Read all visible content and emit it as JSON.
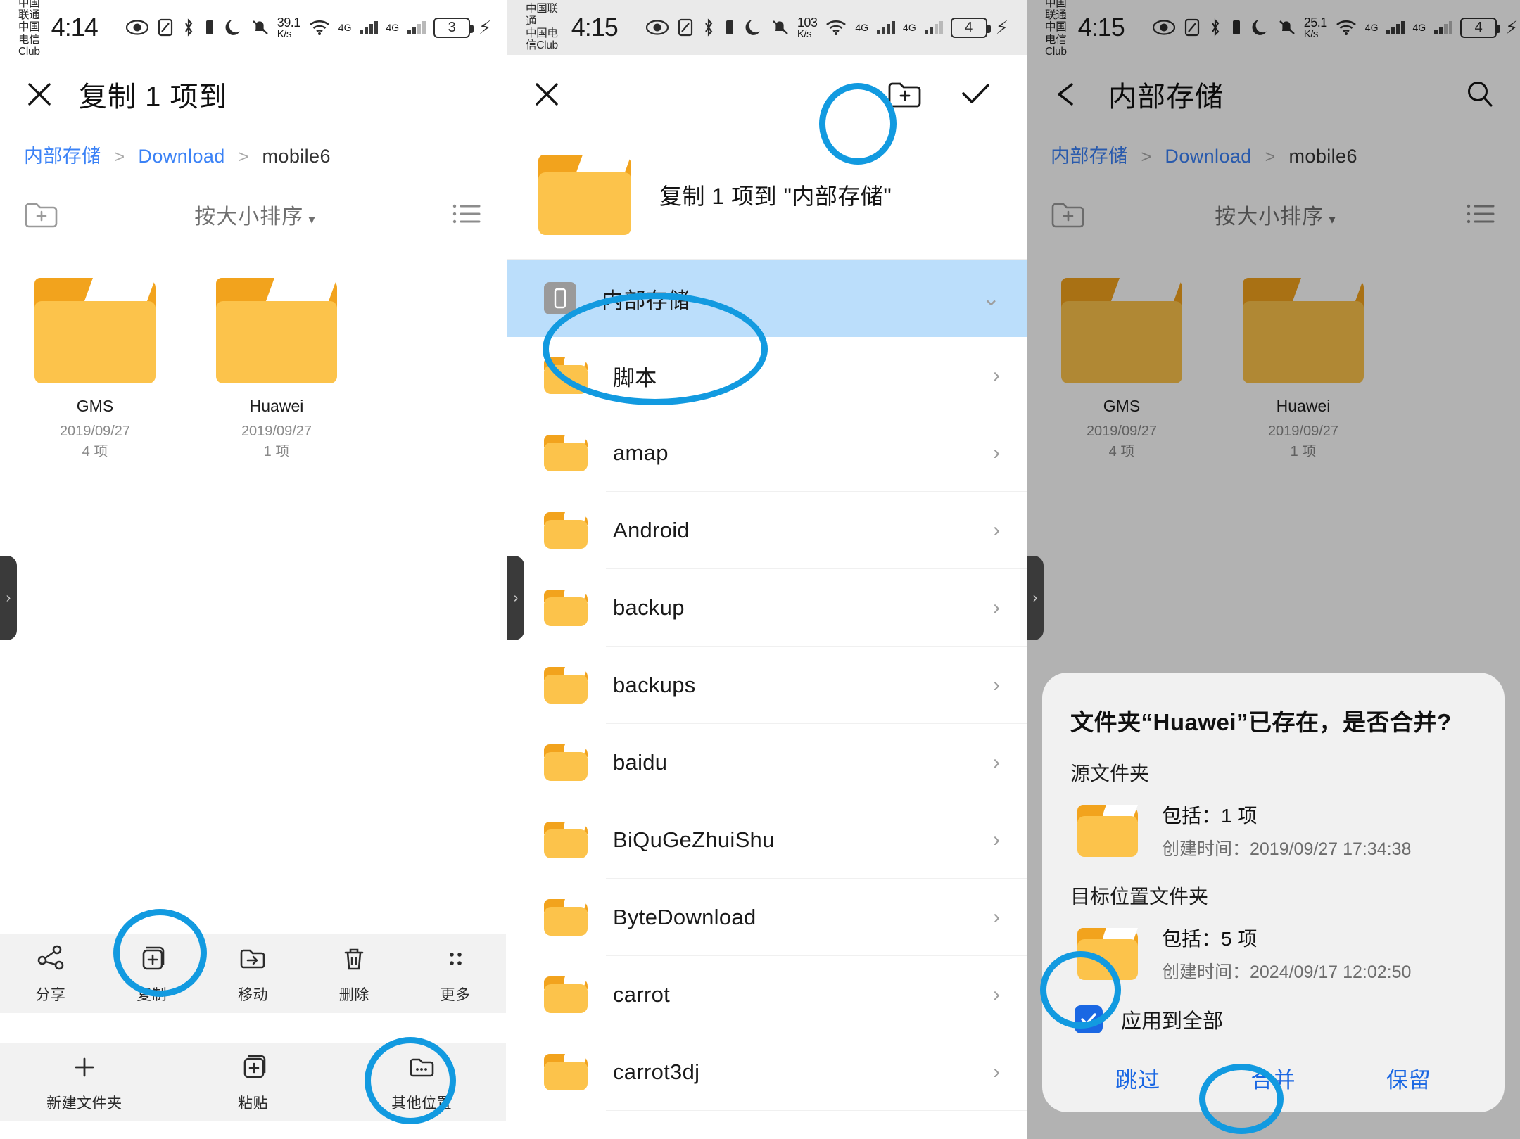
{
  "panel1": {
    "status": {
      "carrier_line1": "中国联通",
      "carrier_line2": "中国电信Club",
      "time": "4:14",
      "net_speed_value": "39.1",
      "net_speed_unit": "K/s",
      "signal1_label": "4G",
      "signal2_label": "4G",
      "battery": "3"
    },
    "appbar": {
      "close_icon": "close-icon",
      "title": "复制 1 项到"
    },
    "breadcrumb": {
      "root": "内部存储",
      "mid": "Download",
      "current": "mobile6",
      "separator": ">"
    },
    "toolbar": {
      "new_folder_icon": "new-folder-icon",
      "sort_label": "按大小排序",
      "caret": "▾",
      "view_icon": "list-view-icon"
    },
    "folders": [
      {
        "name": "GMS",
        "date": "2019/09/27",
        "count": "4 项"
      },
      {
        "name": "Huawei",
        "date": "2019/09/27",
        "count": "1 项"
      }
    ],
    "action_bar": [
      {
        "icon": "share-icon",
        "label": "分享"
      },
      {
        "icon": "copy-icon",
        "label": "复制"
      },
      {
        "icon": "move-icon",
        "label": "移动"
      },
      {
        "icon": "trash-icon",
        "label": "删除"
      },
      {
        "icon": "more-icon",
        "label": "更多"
      }
    ],
    "paste_bar": [
      {
        "icon": "plus-icon",
        "label": "新建文件夹"
      },
      {
        "icon": "paste-icon",
        "label": "粘贴"
      },
      {
        "icon": "other-location-icon",
        "label": "其他位置"
      }
    ]
  },
  "panel2": {
    "status": {
      "carrier_line1": "中国联通",
      "carrier_line2": "中国电信Club",
      "time": "4:15",
      "net_speed_value": "103",
      "net_speed_unit": "K/s",
      "signal1_label": "4G",
      "signal2_label": "4G",
      "battery": "4"
    },
    "appbar": {
      "close_icon": "close-icon",
      "new_folder_icon": "new-folder-icon",
      "confirm_icon": "check-icon"
    },
    "copy_header": {
      "icon": "folder-icon",
      "text": "复制 1 项到 \"内部存储\""
    },
    "list": [
      {
        "name": "内部存储",
        "icon": "device-icon",
        "selected": true,
        "chevron": "⌄"
      },
      {
        "name": "脚本",
        "icon": "folder-icon",
        "selected": false,
        "chevron": "›"
      },
      {
        "name": "amap",
        "icon": "folder-icon",
        "selected": false,
        "chevron": "›"
      },
      {
        "name": "Android",
        "icon": "folder-icon",
        "selected": false,
        "chevron": "›"
      },
      {
        "name": "backup",
        "icon": "folder-icon",
        "selected": false,
        "chevron": "›"
      },
      {
        "name": "backups",
        "icon": "folder-icon",
        "selected": false,
        "chevron": "›"
      },
      {
        "name": "baidu",
        "icon": "folder-icon",
        "selected": false,
        "chevron": "›"
      },
      {
        "name": "BiQuGeZhuiShu",
        "icon": "folder-icon",
        "selected": false,
        "chevron": "›"
      },
      {
        "name": "ByteDownload",
        "icon": "folder-icon",
        "selected": false,
        "chevron": "›"
      },
      {
        "name": "carrot",
        "icon": "folder-icon",
        "selected": false,
        "chevron": "›"
      },
      {
        "name": "carrot3dj",
        "icon": "folder-icon",
        "selected": false,
        "chevron": "›"
      }
    ]
  },
  "panel3": {
    "status": {
      "carrier_line1": "中国联通",
      "carrier_line2": "中国电信Club",
      "time": "4:15",
      "net_speed_value": "25.1",
      "net_speed_unit": "K/s",
      "signal1_label": "4G",
      "signal2_label": "4G",
      "battery": "4"
    },
    "appbar": {
      "back_icon": "back-arrow-icon",
      "title": "内部存储",
      "search_icon": "search-icon"
    },
    "breadcrumb": {
      "root": "内部存储",
      "mid": "Download",
      "current": "mobile6",
      "separator": ">"
    },
    "toolbar": {
      "new_folder_icon": "new-folder-icon",
      "sort_label": "按大小排序",
      "caret": "▾",
      "view_icon": "list-view-icon"
    },
    "folders": [
      {
        "name": "GMS",
        "date": "2019/09/27",
        "count": "4 项"
      },
      {
        "name": "Huawei",
        "date": "2019/09/27",
        "count": "1 项"
      }
    ],
    "dialog": {
      "title": "文件夹“Huawei”已存在，是否合并?",
      "source_label": "源文件夹",
      "source_includes": "包括：1 项",
      "source_created": "创建时间：2019/09/27 17:34:38",
      "target_label": "目标位置文件夹",
      "target_includes": "包括：5 项",
      "target_created": "创建时间：2024/09/17 12:02:50",
      "apply_all_label": "应用到全部",
      "apply_all_checked": true,
      "actions": [
        {
          "label": "跳过"
        },
        {
          "label": "合并"
        },
        {
          "label": "保留"
        }
      ]
    }
  },
  "annotations": {
    "color": "#129ae0",
    "items": [
      "copy-button-circle",
      "other-location-circle",
      "confirm-check-circle",
      "internal-storage-circle",
      "apply-all-checkbox-circle",
      "merge-button-circle"
    ]
  }
}
